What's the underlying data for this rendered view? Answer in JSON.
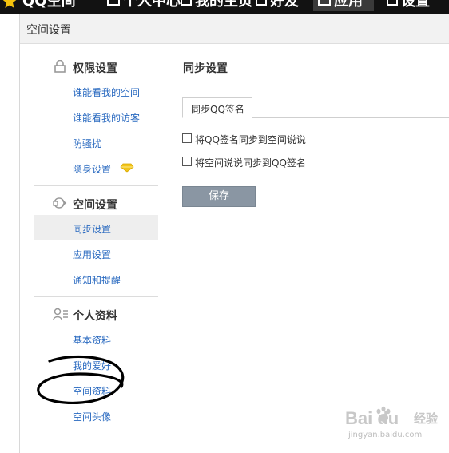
{
  "top_nav": {
    "items": [
      {
        "label": "QQ空间"
      },
      {
        "label": "个人中心"
      },
      {
        "label": "我的主页"
      },
      {
        "label": "好友"
      },
      {
        "label": "应用"
      },
      {
        "label": "设置"
      }
    ],
    "active_index": 4
  },
  "header": {
    "title": "空间设置"
  },
  "sidebar": {
    "sections": [
      {
        "title": "权限设置",
        "icon": "lock-icon",
        "items": [
          "谁能看我的空间",
          "谁能看我的访客",
          "防骚扰",
          "隐身设置"
        ]
      },
      {
        "title": "空间设置",
        "icon": "space-icon",
        "items": [
          "同步设置",
          "应用设置",
          "通知和提醒"
        ]
      },
      {
        "title": "个人资料",
        "icon": "profile-icon",
        "items": [
          "基本资料",
          "我的爱好",
          "空间资料",
          "空间头像"
        ]
      }
    ],
    "selected_item": "同步设置",
    "vip_badge_icon": "yellow-diamond-icon"
  },
  "main": {
    "title": "同步设置",
    "tab": "同步QQ签名",
    "options": [
      {
        "label": "将QQ签名同步到空间说说",
        "checked": false
      },
      {
        "label": "将空间说说同步到QQ签名",
        "checked": false
      }
    ],
    "save_label": "保存"
  },
  "watermark": {
    "logo": "Bai du",
    "sub": "经验",
    "url": "jingyan.baidu.com"
  },
  "colors": {
    "link": "#2a6ac0",
    "top_bar": "#121212",
    "header_bg": "#f2f2f2",
    "save_button": "#8a96a3",
    "vip_badge": "#f2c51b"
  }
}
